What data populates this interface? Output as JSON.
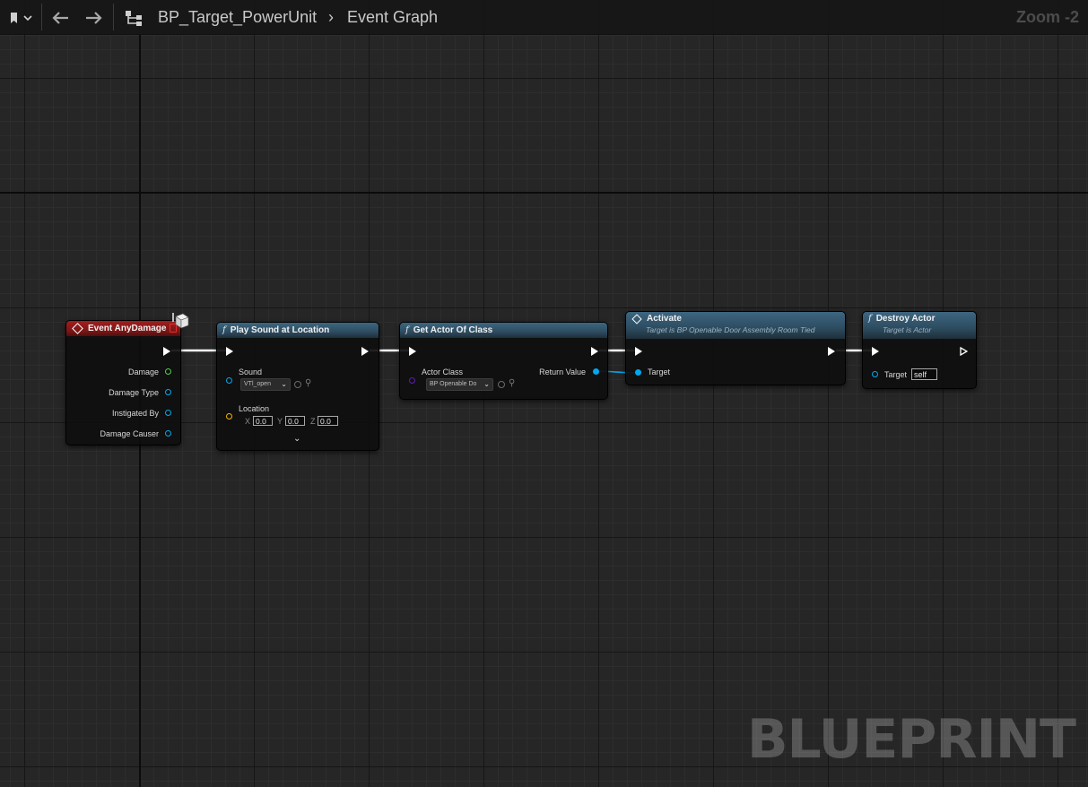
{
  "toolbar": {
    "bookmark_icon": "bookmark-icon",
    "back_icon": "arrow-left-icon",
    "forward_icon": "arrow-right-icon",
    "graph_icon": "graph-hierarchy-icon",
    "breadcrumb_blueprint": "BP_Target_PowerUnit",
    "breadcrumb_graph": "Event Graph",
    "zoom": "Zoom -2"
  },
  "watermark": "BLUEPRINT",
  "colors": {
    "exec_wire": "#ffffff",
    "object_pin": "#00a8f0",
    "float_pin": "#4fd14f",
    "vector_pin": "#f5b400",
    "class_pin": "#5a1fb0",
    "event_header": "#8b1a1a",
    "function_header": "#35566d"
  },
  "nodes": {
    "event_any_damage": {
      "title": "Event AnyDamage",
      "pins": [
        "Damage",
        "Damage Type",
        "Instigated By",
        "Damage Causer"
      ]
    },
    "play_sound": {
      "title": "Play Sound at Location",
      "sound_label": "Sound",
      "sound_value": "VTl_open",
      "location_label": "Location",
      "x_label": "X",
      "x_value": "0.0",
      "y_label": "Y",
      "y_value": "0.0",
      "z_label": "Z",
      "z_value": "0.0"
    },
    "get_actor_of_class": {
      "title": "Get Actor Of Class",
      "actor_class_label": "Actor Class",
      "actor_class_value": "BP Openable Do",
      "return_label": "Return Value"
    },
    "activate": {
      "title": "Activate",
      "subtitle": "Target is BP Openable Door Assembly Room Tied",
      "target_label": "Target"
    },
    "destroy_actor": {
      "title": "Destroy Actor",
      "subtitle": "Target is Actor",
      "target_label": "Target",
      "target_value": "self"
    }
  }
}
